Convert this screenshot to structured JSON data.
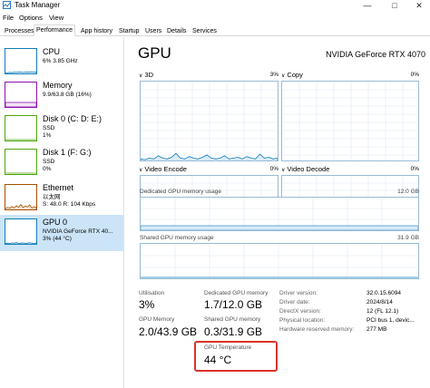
{
  "window": {
    "title": "Task Manager"
  },
  "menu": [
    {
      "label": "File"
    },
    {
      "label": "Options"
    },
    {
      "label": "View"
    }
  ],
  "tabs": [
    {
      "label": "Processes",
      "active": false
    },
    {
      "label": "Performance",
      "active": true
    },
    {
      "label": "App history",
      "active": false
    },
    {
      "label": "Startup",
      "active": false
    },
    {
      "label": "Users",
      "active": false
    },
    {
      "label": "Details",
      "active": false
    },
    {
      "label": "Services",
      "active": false
    }
  ],
  "sidebar": {
    "items": [
      {
        "name": "CPU",
        "line1": "6% 3.85 GHz",
        "line2": "",
        "color": "#117dbb"
      },
      {
        "name": "Memory",
        "line1": "9.9/63.8 GB (16%)",
        "line2": "",
        "color": "#8b12ae"
      },
      {
        "name": "Disk 0 (C: D: E:)",
        "line1": "SSD",
        "line2": "1%",
        "color": "#4da60c"
      },
      {
        "name": "Disk 1 (F: G:)",
        "line1": "SSD",
        "line2": "0%",
        "color": "#4da60c"
      },
      {
        "name": "Ethernet",
        "line1": "以太网",
        "line2": "S: 48.0  R: 104 Kbps",
        "color": "#a74f01"
      },
      {
        "name": "GPU 0",
        "line1": "NVIDIA GeForce RTX 40...",
        "line2": "3% (44 °C)",
        "color": "#117dbb",
        "selected": true
      }
    ]
  },
  "main": {
    "title": "GPU",
    "model": "NVIDIA GeForce RTX 4070",
    "engines": [
      {
        "name": "3D",
        "percent": "3%"
      },
      {
        "name": "Copy",
        "percent": "0%"
      },
      {
        "name": "Video Encode",
        "percent": "0%"
      },
      {
        "name": "Video Decode",
        "percent": "0%"
      }
    ],
    "dedicated_memory": {
      "label": "Dedicated GPU memory usage",
      "max": "12.0 GB"
    },
    "shared_memory": {
      "label": "Shared GPU memory usage",
      "max": "31.9 GB"
    },
    "stats": {
      "utilisation": {
        "label": "Utilisation",
        "value": "3%"
      },
      "dedicated": {
        "label": "Dedicated GPU memory",
        "value": "1.7/12.0 GB"
      },
      "gpu_memory": {
        "label": "GPU Memory",
        "value": "2.0/43.9 GB"
      },
      "shared": {
        "label": "Shared GPU memory",
        "value": "0.3/31.9 GB"
      },
      "temperature": {
        "label": "GPU Temperature",
        "value": "44 °C"
      }
    },
    "info": [
      {
        "key": "Driver version:",
        "value": "32.0.15.6094"
      },
      {
        "key": "Driver date:",
        "value": "2024/8/14"
      },
      {
        "key": "DirectX version:",
        "value": "12 (FL 12.1)"
      },
      {
        "key": "Physical location:",
        "value": "PCI bus 1, devic..."
      },
      {
        "key": "Hardware reserved memory:",
        "value": "277 MB"
      }
    ]
  },
  "graph_series": {
    "cpu_thumb": [
      2,
      3,
      4,
      3,
      5,
      4,
      6,
      5,
      4,
      5,
      6,
      5,
      7,
      5,
      6
    ],
    "gpu_3d": [
      2,
      1,
      3,
      2,
      6,
      3,
      2,
      4,
      9,
      3,
      2,
      5,
      3,
      2,
      4,
      7,
      3,
      2,
      3,
      6,
      2,
      3,
      4,
      2,
      5,
      3,
      2,
      8,
      3,
      4,
      2,
      3
    ],
    "ethernet_thumb": [
      3,
      8,
      5,
      12,
      6,
      15,
      9,
      20,
      7,
      14,
      10,
      18,
      6,
      11,
      9
    ],
    "gpu_thumb": [
      2,
      3,
      2,
      4,
      3,
      5,
      2,
      3,
      4,
      2,
      3,
      5,
      3,
      2,
      4
    ]
  }
}
